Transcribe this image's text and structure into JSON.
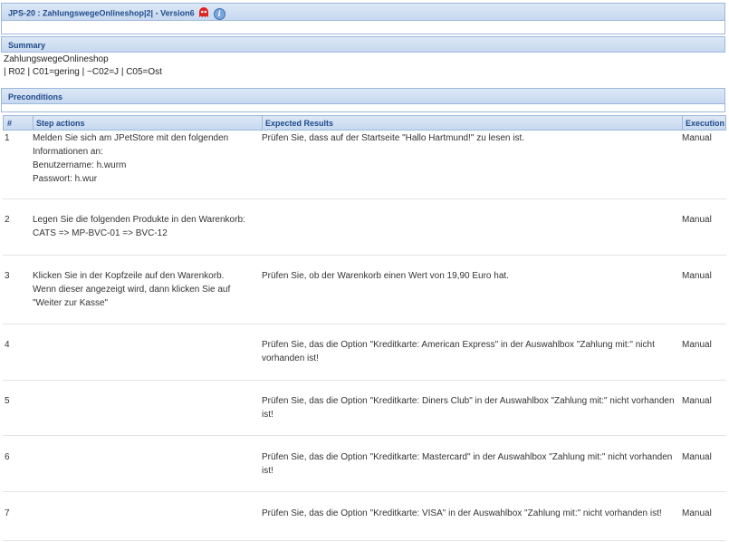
{
  "title": {
    "text": "JPS-20 : ZahlungswegeOnlineshop|2| - Version6",
    "icons": [
      "ghost-icon",
      "info-icon"
    ]
  },
  "summary": {
    "label": "Summary",
    "line1": "ZahlungswegeOnlineshop",
    "line2": "| R02 | C01=gering | ~C02=J | C05=Ost"
  },
  "preconditions": {
    "label": "Preconditions"
  },
  "table": {
    "headers": {
      "num": "#",
      "step": "Step actions",
      "expected": "Expected Results",
      "execution": "Execution"
    },
    "rows": [
      {
        "num": "1",
        "step": [
          "Melden Sie sich am JPetStore mit den folgenden",
          "Informationen an:",
          "Benutzername: h.wurm",
          "Passwort: h.wur"
        ],
        "expected": [
          "Prüfen Sie, dass auf der Startseite \"Hallo Hartmund!\" zu lesen ist."
        ],
        "execution": "Manual"
      },
      {
        "num": "2",
        "step": [
          "Legen Sie die folgenden Produkte in den Warenkorb:",
          "CATS => MP-BVC-01 => BVC-12"
        ],
        "expected": [],
        "execution": "Manual"
      },
      {
        "num": "3",
        "step": [
          "Klicken Sie in der Kopfzeile auf den Warenkorb.",
          "Wenn dieser angezeigt wird, dann klicken Sie auf",
          "\"Weiter zur Kasse\""
        ],
        "expected": [
          "Prüfen Sie, ob der Warenkorb einen Wert von 19,90 Euro hat."
        ],
        "execution": "Manual"
      },
      {
        "num": "4",
        "step": [],
        "expected": [
          "Prüfen Sie, das die Option \"Kreditkarte: American Express\" in der Auswahlbox \"Zahlung mit:\" nicht",
          "vorhanden ist!"
        ],
        "execution": "Manual"
      },
      {
        "num": "5",
        "step": [],
        "expected": [
          "Prüfen Sie, das die Option \"Kreditkarte: Diners Club\" in der Auswahlbox \"Zahlung mit:\" nicht vorhanden",
          "ist!"
        ],
        "execution": "Manual"
      },
      {
        "num": "6",
        "step": [],
        "expected": [
          "Prüfen Sie, das die Option \"Kreditkarte: Mastercard\" in der Auswahlbox \"Zahlung mit:\" nicht vorhanden",
          "ist!"
        ],
        "execution": "Manual"
      },
      {
        "num": "7",
        "step": [],
        "expected": [
          "Prüfen Sie, das die Option \"Kreditkarte: VISA\" in der Auswahlbox \"Zahlung mit:\" nicht vorhanden ist!"
        ],
        "execution": "Manual"
      }
    ]
  }
}
